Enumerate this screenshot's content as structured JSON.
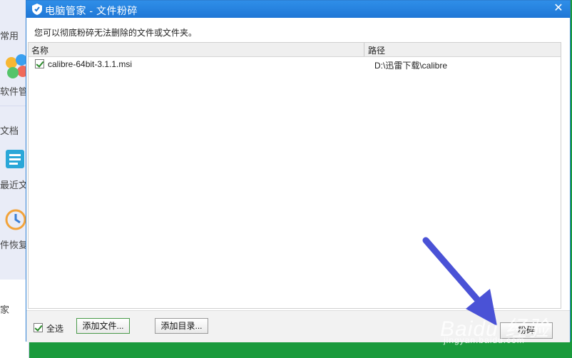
{
  "background_app": {
    "items": [
      "常用",
      "软件管",
      "文档",
      "最近文",
      "件恢复",
      "家"
    ]
  },
  "dialog": {
    "title": "电脑管家 - 文件粉碎",
    "description": "您可以彻底粉碎无法删除的文件或文件夹。",
    "columns": [
      "名称",
      "路径"
    ],
    "rows": [
      {
        "checked": true,
        "name": "calibre-64bit-3.1.1.msi",
        "path": "D:\\迅雷下载\\calibre"
      }
    ],
    "select_all_label": "全选",
    "select_all_checked": true,
    "add_file_label": "添加文件...",
    "add_dir_label": "添加目录...",
    "shred_label": "粉碎"
  },
  "watermark": {
    "brand": "Baidu 经验",
    "url": "jingyan.baidu.com"
  },
  "colors": {
    "titlebar": "#1f77d6",
    "arrow": "#4a52d6",
    "background": "#1a9a3c"
  }
}
